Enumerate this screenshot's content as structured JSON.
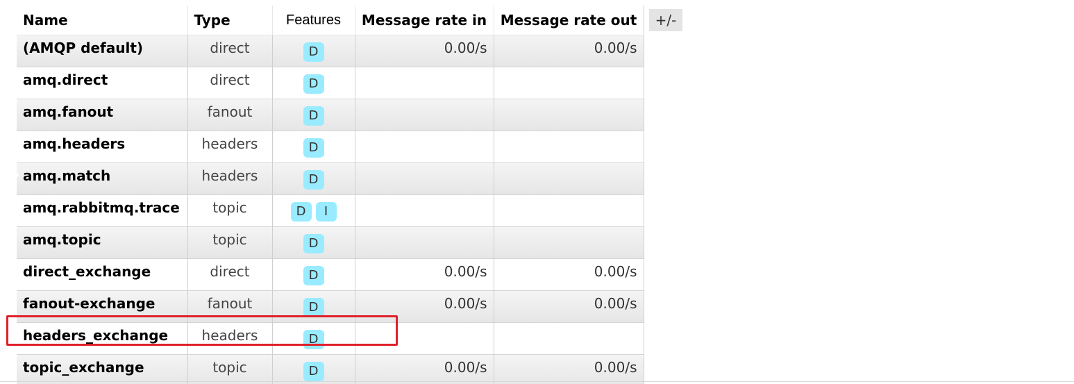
{
  "table": {
    "columns": {
      "name": "Name",
      "type": "Type",
      "features": "Features",
      "rate_in": "Message rate in",
      "rate_out": "Message rate out"
    },
    "column_toggle_label": "+/-",
    "rows": [
      {
        "name": "(AMQP default)",
        "type": "direct",
        "features": [
          "D"
        ],
        "rate_in": "0.00/s",
        "rate_out": "0.00/s"
      },
      {
        "name": "amq.direct",
        "type": "direct",
        "features": [
          "D"
        ],
        "rate_in": "",
        "rate_out": ""
      },
      {
        "name": "amq.fanout",
        "type": "fanout",
        "features": [
          "D"
        ],
        "rate_in": "",
        "rate_out": ""
      },
      {
        "name": "amq.headers",
        "type": "headers",
        "features": [
          "D"
        ],
        "rate_in": "",
        "rate_out": ""
      },
      {
        "name": "amq.match",
        "type": "headers",
        "features": [
          "D"
        ],
        "rate_in": "",
        "rate_out": ""
      },
      {
        "name": "amq.rabbitmq.trace",
        "type": "topic",
        "features": [
          "D",
          "I"
        ],
        "rate_in": "",
        "rate_out": ""
      },
      {
        "name": "amq.topic",
        "type": "topic",
        "features": [
          "D"
        ],
        "rate_in": "",
        "rate_out": ""
      },
      {
        "name": "direct_exchange",
        "type": "direct",
        "features": [
          "D"
        ],
        "rate_in": "0.00/s",
        "rate_out": "0.00/s"
      },
      {
        "name": "fanout-exchange",
        "type": "fanout",
        "features": [
          "D"
        ],
        "rate_in": "0.00/s",
        "rate_out": "0.00/s"
      },
      {
        "name": "headers_exchange",
        "type": "headers",
        "features": [
          "D"
        ],
        "rate_in": "",
        "rate_out": ""
      },
      {
        "name": "topic_exchange",
        "type": "topic",
        "features": [
          "D"
        ],
        "rate_in": "0.00/s",
        "rate_out": "0.00/s"
      }
    ]
  },
  "colors": {
    "feature_badge": "#99ebff",
    "highlight_outline": "#e0202a",
    "column_toggle_bg": "#e4e4e4"
  }
}
